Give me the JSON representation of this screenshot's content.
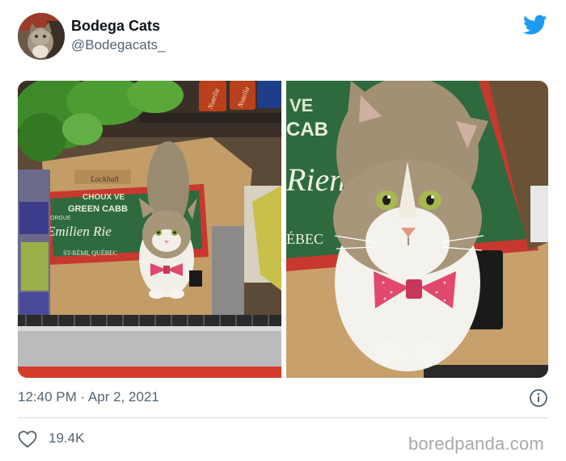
{
  "tweet": {
    "author_name": "Bodega Cats",
    "author_handle": "@Bodegacats_",
    "timestamp": "12:40 PM · Apr 2, 2021",
    "likes": "19.4K"
  },
  "icons": {
    "platform": "bird-icon",
    "info": "info-icon",
    "like": "heart-icon"
  },
  "box_print": {
    "brand": "Lockhalt",
    "line1": "CHOUX VE",
    "line2": "GREEN CABB",
    "line3": "ORGUE",
    "line4": "Emilien Rie",
    "line5": "ST-RÉMI, QUÉBEC",
    "zoom1": "VE",
    "zoom2": "CAB",
    "zoom3": "Rien",
    "zoom4": "ÉBEC"
  },
  "cans": {
    "label": "Nutella"
  },
  "watermark": "boredpanda.com",
  "colors": {
    "accent": "#1d9bf0",
    "text": "#0f1419",
    "secondary": "#536471",
    "divider": "#cfd9de",
    "bowtie": "#e0486e",
    "box_green": "#2f6a3e",
    "box_red": "#c8382e"
  }
}
